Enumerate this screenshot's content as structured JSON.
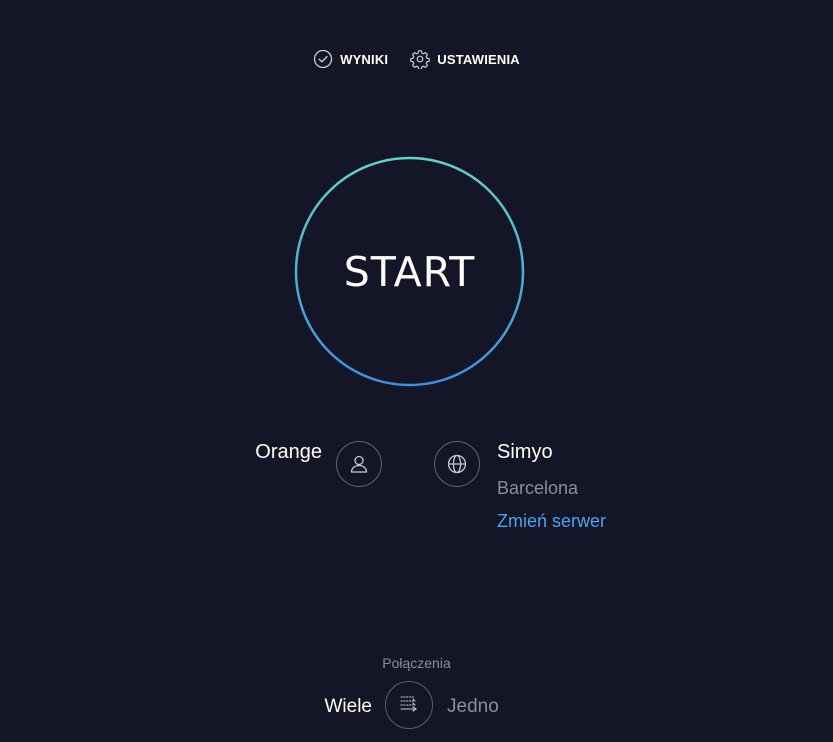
{
  "nav": {
    "results_label": "WYNIKI",
    "settings_label": "USTAWIENIA"
  },
  "start": {
    "label": "START",
    "ring_colors": [
      "#5ed3c6",
      "#3d8fe0"
    ]
  },
  "isp": {
    "name": "Orange",
    "icon": "user-icon"
  },
  "server": {
    "icon": "globe-icon",
    "name": "Simyo",
    "location": "Barcelona",
    "change_label": "Zmień serwer"
  },
  "connections": {
    "label": "Połączenia",
    "multi_label": "Wiele",
    "single_label": "Jedno",
    "selected": "Wiele",
    "icon": "multi-connection-icon"
  },
  "colors": {
    "background": "#141526",
    "link": "#4aa3f0",
    "muted_text": "#8b8d9e"
  }
}
